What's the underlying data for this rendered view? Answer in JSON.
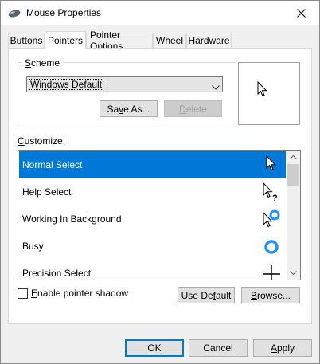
{
  "window": {
    "title": "Mouse Properties",
    "icon": "mouse-icon",
    "close": "close-icon"
  },
  "tabs": [
    {
      "label": "Buttons",
      "active": false
    },
    {
      "label": "Pointers",
      "active": true
    },
    {
      "label": "Pointer Options",
      "active": false
    },
    {
      "label": "Wheel",
      "active": false
    },
    {
      "label": "Hardware",
      "active": false
    }
  ],
  "scheme": {
    "group_label_key": "S",
    "group_label_rest": "cheme",
    "selected": "Windows Default",
    "save_as_key": "v",
    "save_as_pre": "Sa",
    "save_as_post": "e As...",
    "delete_key": "D",
    "delete_rest": "elete"
  },
  "customize": {
    "label_key": "C",
    "label_rest": "ustomize:",
    "items": [
      {
        "label": "Normal Select",
        "cursor": "arrow-cursor-icon",
        "selected": true
      },
      {
        "label": "Help Select",
        "cursor": "help-cursor-icon",
        "selected": false
      },
      {
        "label": "Working In Background",
        "cursor": "working-cursor-icon",
        "selected": false
      },
      {
        "label": "Busy",
        "cursor": "busy-cursor-icon",
        "selected": false
      },
      {
        "label": "Precision Select",
        "cursor": "crosshair-cursor-icon",
        "selected": false
      }
    ]
  },
  "shadow": {
    "key": "E",
    "rest": "nable pointer shadow",
    "checked": false
  },
  "use_default": {
    "key": "f",
    "pre": "Use De",
    "post": "ault"
  },
  "browse": {
    "key": "B",
    "rest": "rowse..."
  },
  "footer": {
    "ok": "OK",
    "cancel": "Cancel",
    "apply_key": "A",
    "apply_rest": "pply"
  },
  "colors": {
    "selection": "#0078d7",
    "busy_ring": "#1e90ff"
  }
}
